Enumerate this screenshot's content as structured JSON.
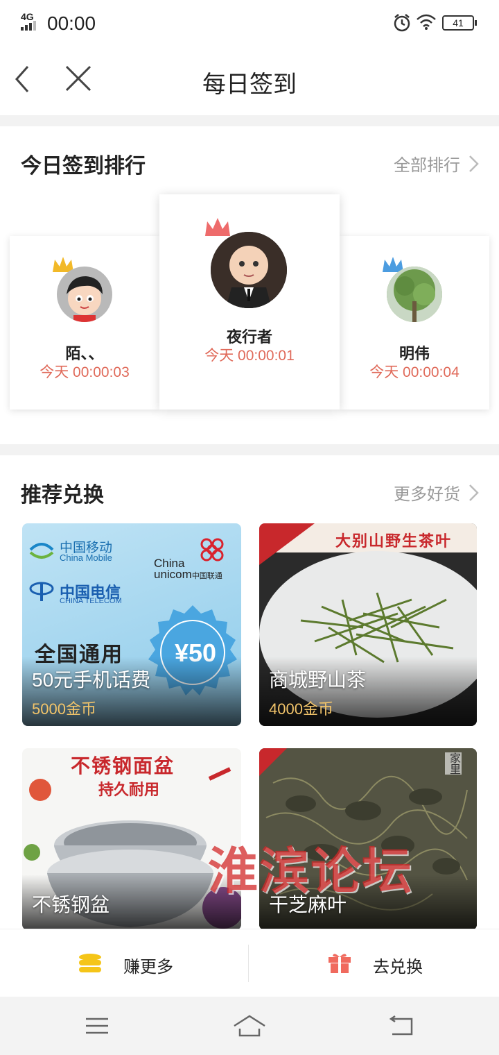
{
  "status_bar": {
    "network": "4G",
    "time": "00:00",
    "battery": "41",
    "icons": [
      "alarm-icon",
      "wifi-icon",
      "battery-icon"
    ]
  },
  "nav": {
    "title": "每日签到",
    "icons": [
      "back-icon",
      "close-icon"
    ]
  },
  "ranking": {
    "title": "今日签到排行",
    "more": "全部排行",
    "entries": [
      {
        "rank": 2,
        "name": "陌、、",
        "time": "今天 00:00:03"
      },
      {
        "rank": 1,
        "name": "夜行者",
        "time": "今天 00:00:01"
      },
      {
        "rank": 3,
        "name": "明伟",
        "time": "今天 00:00:04"
      }
    ]
  },
  "exchange": {
    "title": "推荐兑换",
    "more": "更多好货",
    "products": [
      {
        "name": "50元手机话费",
        "price": "5000金币",
        "art": {
          "brand1_cn": "中国移动",
          "brand1_en": "China Mobile",
          "brand2_cn": "中国电信",
          "brand2_en": "CHINA TELECOM",
          "brand3_en1": "China",
          "brand3_en2": "unicom",
          "brand3_cn": "中国联通",
          "slogan": "全国通用",
          "amount": "¥50"
        }
      },
      {
        "name": "商城野山茶",
        "price": "4000金币",
        "art": {
          "banner": "大别山野生茶叶"
        }
      },
      {
        "name": "不锈钢盆",
        "price": "",
        "art": {
          "headline": "不锈钢面盆",
          "sub": "持久耐用"
        }
      },
      {
        "name": "干芝麻叶",
        "price": "",
        "art": {
          "corner": "家里"
        }
      }
    ]
  },
  "watermark": "淮滨论坛",
  "bottom_bar": {
    "earn_label": "赚更多",
    "exchange_label": "去兑换"
  },
  "colors": {
    "accent_red": "#e06a5a",
    "coin_gold": "#f2c46a",
    "coin_icon": "#f5c518",
    "gift_icon": "#f06a5e"
  }
}
